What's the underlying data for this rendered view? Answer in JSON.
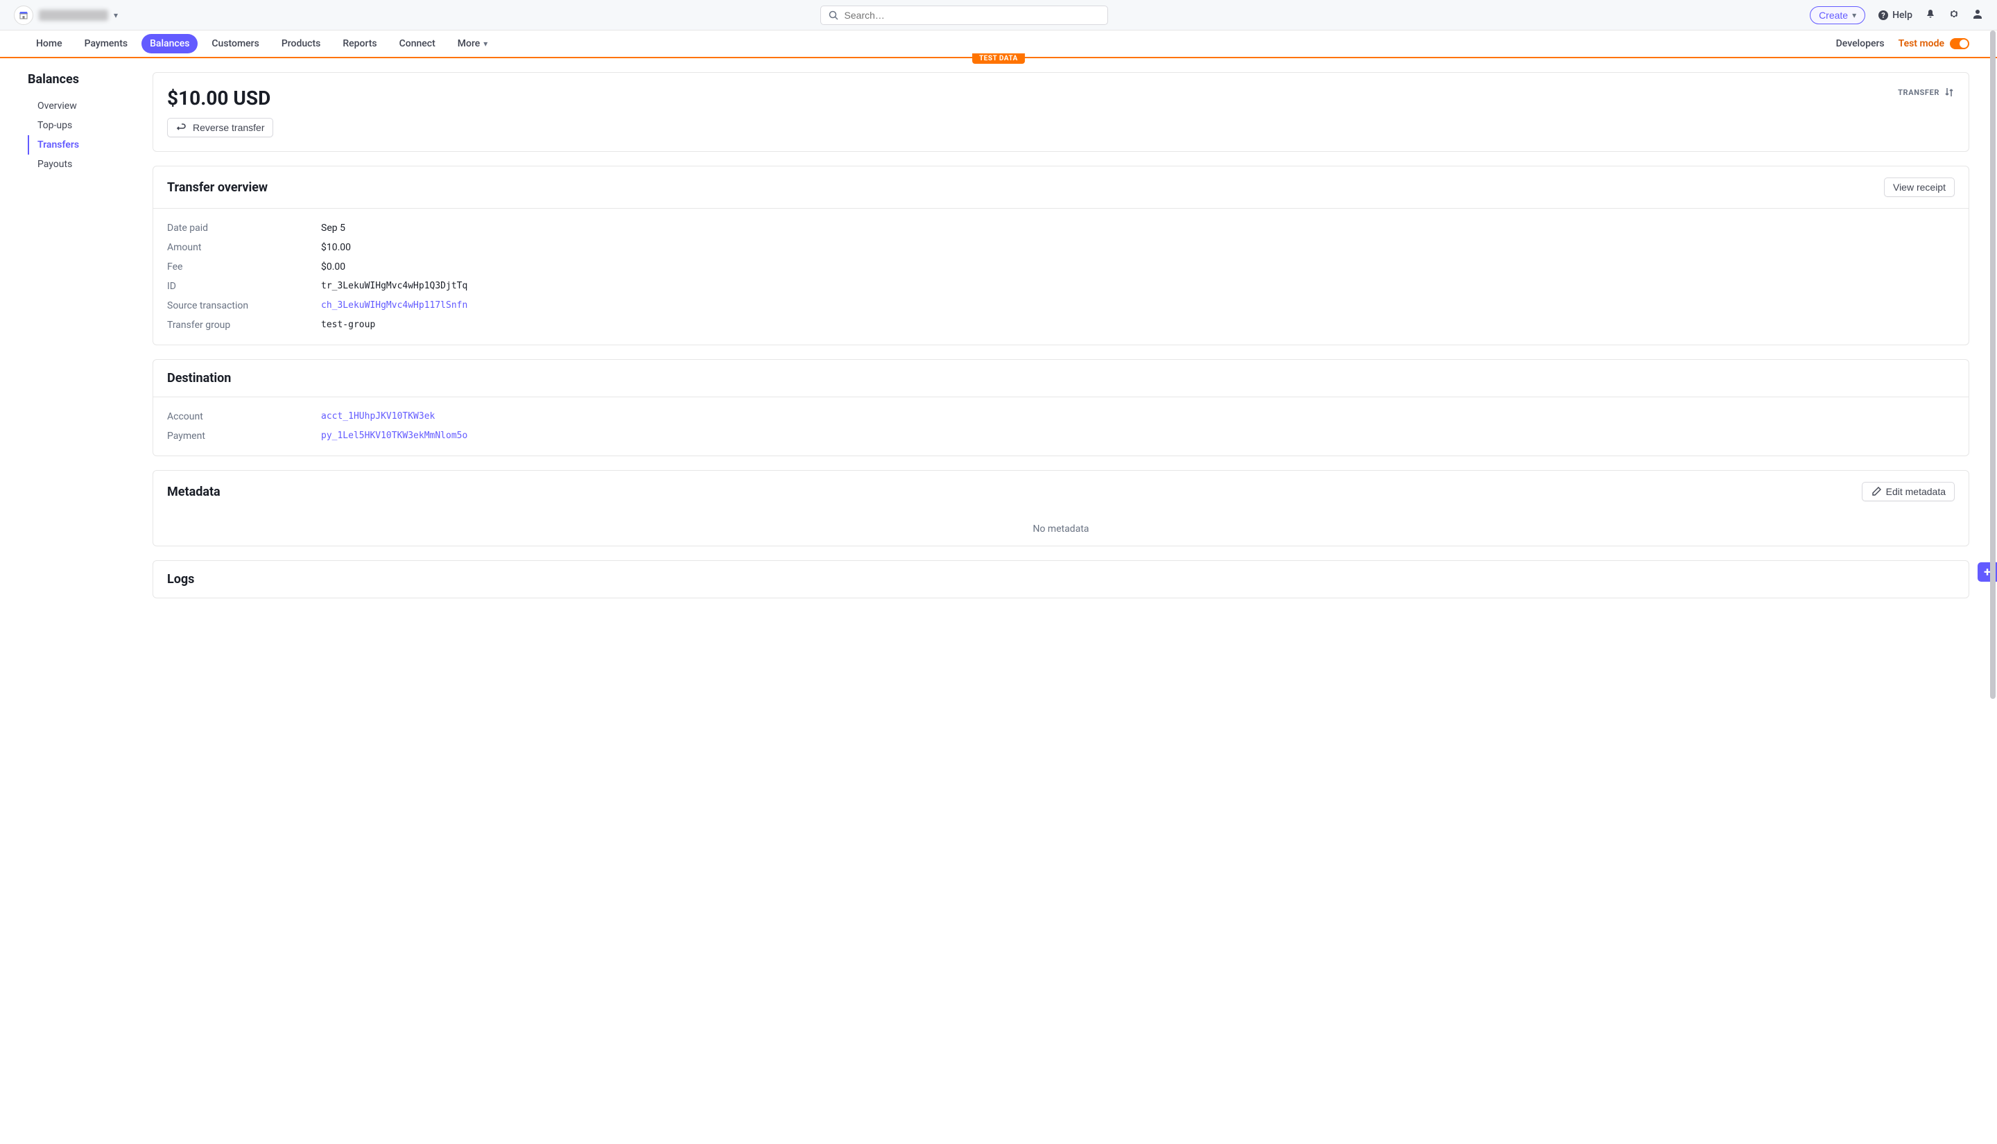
{
  "topbar": {
    "search_placeholder": "Search…",
    "create_label": "Create",
    "help_label": "Help"
  },
  "nav": {
    "items": [
      "Home",
      "Payments",
      "Balances",
      "Customers",
      "Products",
      "Reports",
      "Connect",
      "More"
    ],
    "developers": "Developers",
    "test_mode_label": "Test mode",
    "test_data_badge": "TEST DATA"
  },
  "sidebar": {
    "title": "Balances",
    "items": [
      "Overview",
      "Top-ups",
      "Transfers",
      "Payouts"
    ]
  },
  "header": {
    "amount_title": "$10.00 USD",
    "badge": "TRANSFER",
    "reverse_btn": "Reverse transfer"
  },
  "overview": {
    "title": "Transfer overview",
    "view_receipt": "View receipt",
    "rows": {
      "date_paid_label": "Date paid",
      "date_paid_value": "Sep 5",
      "amount_label": "Amount",
      "amount_value": "$10.00",
      "fee_label": "Fee",
      "fee_value": "$0.00",
      "id_label": "ID",
      "id_value": "tr_3LekuWIHgMvc4wHp1Q3DjtTq",
      "source_label": "Source transaction",
      "source_value": "ch_3LekuWIHgMvc4wHp117lSnfn",
      "group_label": "Transfer group",
      "group_value": "test-group"
    }
  },
  "destination": {
    "title": "Destination",
    "account_label": "Account",
    "account_value": "acct_1HUhpJKV10TKW3ek",
    "payment_label": "Payment",
    "payment_value": "py_1Lel5HKV10TKW3ekMmNlom5o"
  },
  "metadata": {
    "title": "Metadata",
    "edit_btn": "Edit metadata",
    "empty": "No metadata"
  },
  "logs": {
    "title": "Logs"
  }
}
